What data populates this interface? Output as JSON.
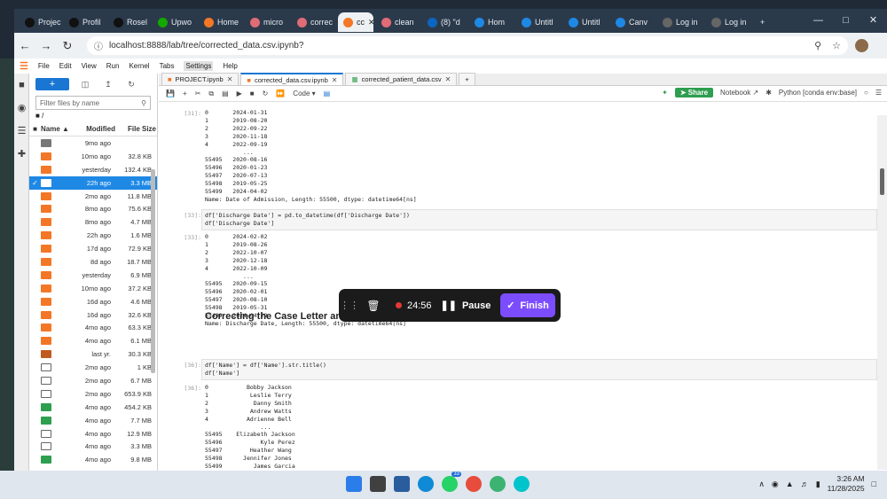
{
  "browser": {
    "tabs": [
      {
        "label": "Projec",
        "color": "#111111"
      },
      {
        "label": "Profil",
        "color": "#111111"
      },
      {
        "label": "Rosel",
        "color": "#111111"
      },
      {
        "label": "Upwo",
        "color": "#14a800"
      },
      {
        "label": "Home",
        "color": "#f37726"
      },
      {
        "label": "micro",
        "color": "#e06c75"
      },
      {
        "label": "correc",
        "color": "#e06c75"
      },
      {
        "label": "cc",
        "color": "#f37726"
      },
      {
        "label": "clean",
        "color": "#e06c75"
      },
      {
        "label": "(8) \"d",
        "color": "#0a66c2"
      },
      {
        "label": "Hom",
        "color": "#1e88e5"
      },
      {
        "label": "Untitl",
        "color": "#1e88e5"
      },
      {
        "label": "Untitl",
        "color": "#1e88e5"
      },
      {
        "label": "Canv",
        "color": "#1e88e5"
      },
      {
        "label": "Log in",
        "color": "#666666"
      },
      {
        "label": "Log in",
        "color": "#666666"
      }
    ],
    "url": "localhost:8888/lab/tree/corrected_data.csv.ipynb?"
  },
  "menu": [
    "File",
    "Edit",
    "View",
    "Run",
    "Kernel",
    "Tabs",
    "Settings",
    "Help"
  ],
  "filebrowser": {
    "new_label": "+",
    "search_placeholder": "Filter files by name",
    "breadcrumb": "/",
    "headers": {
      "name": "Name",
      "modified": "Modified",
      "size": "File Size"
    },
    "rows": [
      {
        "modified": "9mo ago",
        "size": "",
        "type": "folder"
      },
      {
        "modified": "10mo ago",
        "size": "32.8 KB",
        "type": "notebook"
      },
      {
        "modified": "yesterday",
        "size": "132.4 KB",
        "type": "notebook"
      },
      {
        "modified": "22h ago",
        "size": "3.3 MB",
        "type": "notebook",
        "selected": true
      },
      {
        "modified": "2mo ago",
        "size": "11.8 MB",
        "type": "notebook"
      },
      {
        "modified": "8mo ago",
        "size": "75.6 KB",
        "type": "notebook"
      },
      {
        "modified": "8mo ago",
        "size": "4.7 MB",
        "type": "notebook"
      },
      {
        "modified": "22h ago",
        "size": "1.6 MB",
        "type": "notebook"
      },
      {
        "modified": "17d ago",
        "size": "72.9 KB",
        "type": "notebook"
      },
      {
        "modified": "8d ago",
        "size": "18.7 MB",
        "type": "notebook"
      },
      {
        "modified": "yesterday",
        "size": "6.9 MB",
        "type": "notebook"
      },
      {
        "modified": "10mo ago",
        "size": "37.2 KB",
        "type": "notebook"
      },
      {
        "modified": "16d ago",
        "size": "4.6 MB",
        "type": "notebook"
      },
      {
        "modified": "16d ago",
        "size": "32.6 KB",
        "type": "notebook"
      },
      {
        "modified": "4mo ago",
        "size": "63.3 KB",
        "type": "notebook"
      },
      {
        "modified": "4mo ago",
        "size": "6.1 MB",
        "type": "notebook"
      },
      {
        "modified": "last yr.",
        "size": "30.3 KB",
        "type": "other"
      },
      {
        "modified": "2mo ago",
        "size": "1 KB",
        "type": "file"
      },
      {
        "modified": "2mo ago",
        "size": "6.7 MB",
        "type": "file"
      },
      {
        "modified": "2mo ago",
        "size": "653.9 KB",
        "type": "file"
      },
      {
        "modified": "4mo ago",
        "size": "454.2 KB",
        "type": "csv"
      },
      {
        "modified": "4mo ago",
        "size": "7.7 MB",
        "type": "csv"
      },
      {
        "modified": "4mo ago",
        "size": "12.9 MB",
        "type": "file"
      },
      {
        "modified": "4mo ago",
        "size": "3.3 MB",
        "type": "file"
      },
      {
        "modified": "4mo ago",
        "size": "9.8 MB",
        "type": "csv"
      }
    ]
  },
  "doctabs": [
    {
      "label": "PROJECT.ipynb",
      "active": false
    },
    {
      "label": "corrected_data.csv.ipynb",
      "active": true
    },
    {
      "label": "corrected_patient_data.csv",
      "active": false
    }
  ],
  "toolbar": {
    "cell_type": "Code",
    "share": "Share",
    "notebook": "Notebook",
    "kernel": "Python [conda env:base]"
  },
  "cells": {
    "c1_prompt": "[31]:",
    "c1_out": "0       2024-01-31\n1       2019-08-20\n2       2022-09-22\n3       2020-11-18\n4       2022-09-19\n           ...\n55495   2020-08-16\n55496   2020-01-23\n55497   2020-07-13\n55498   2019-05-25\n55499   2024-04-02\nName: Date of Admission, Length: 55500, dtype: datetime64[ns]",
    "c2_prompt": "[33]:",
    "c2_in_line1": "df['Discharge Date'] = pd.to_datetime(df['Discharge Date'])",
    "c2_in_line2": "df['Discharge Date']",
    "c2_out_prompt": "[33]:",
    "c2_out": "0       2024-02-02\n1       2019-08-26\n2       2022-10-07\n3       2020-12-18\n4       2022-10-09\n           ...\n55495   2020-09-15\n55496   2020-02-01\n55497   2020-08-10\n55498   2019-05-31\n55499   2024-04-29\nName: Discharge Date, Length: 55500, dtype: datetime64[ns]",
    "heading": "Correcting the Case Letter and Removing Unnecessary Spacing",
    "c3_prompt": "[36]:",
    "c3_in_line1": "df['Name'] = df['Name'].str.title()",
    "c3_in_line2": "df['Name']",
    "c3_out_prompt": "[36]:",
    "c3_out": "0           Bobby Jackson\n1            Leslie Terry\n2             Danny Smith\n3            Andrew Watts\n4           Adrienne Bell\n                ...\n55495    Elizabeth Jackson\n55496           Kyle Perez\n55497        Heather Wang\n55498      Jennifer Jones\n55499         James Garcia"
  },
  "recorder": {
    "time": "24:56",
    "pause": "Pause",
    "finish": "Finish"
  },
  "taskbar": {
    "time": "3:26 AM",
    "date": "11/28/2025",
    "badge": "33"
  }
}
